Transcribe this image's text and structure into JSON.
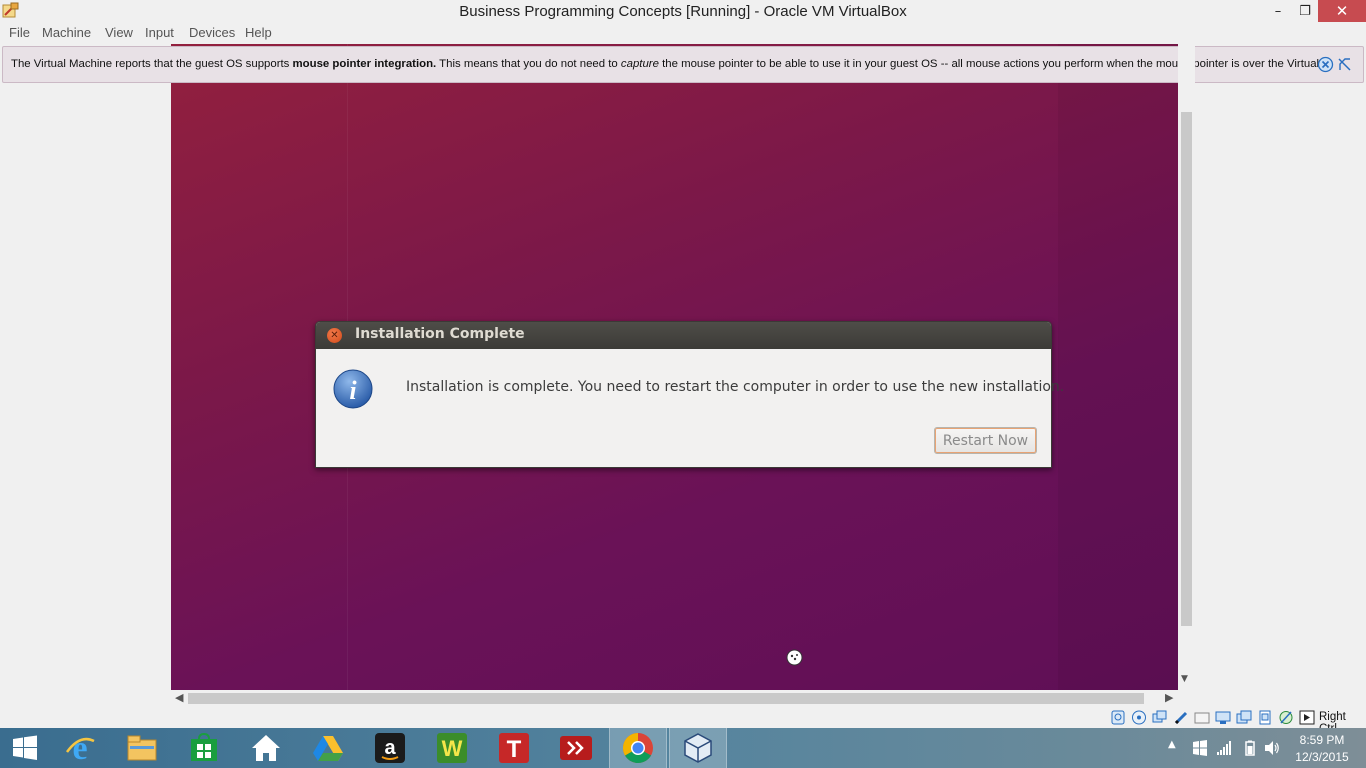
{
  "window": {
    "title": "Business Programming Concepts [Running] - Oracle VM VirtualBox",
    "minimize_glyph": "–",
    "restore_glyph": "❐",
    "close_glyph": "✕"
  },
  "menubar": {
    "items": [
      "File",
      "Machine",
      "View",
      "Input",
      "Devices",
      "Help"
    ]
  },
  "notification": {
    "text_before": "The Virtual Machine reports that the guest OS supports ",
    "bold": "mouse pointer integration.",
    "text_middle": " This means that you do not need to ",
    "italic": "capture",
    "text_after": " the mouse pointer to be able to use it in your guest OS -- all mouse actions you perform when the mouse pointer is over the Virtual"
  },
  "dialog": {
    "title": "Installation Complete",
    "message": "Installation is complete. You need to restart the computer in order to use the new installation.",
    "button": "Restart Now"
  },
  "statusbar": {
    "icons": [
      "hard-disk-icon",
      "optical-drive-icon",
      "audio-icon",
      "network-icon",
      "usb-icon",
      "shared-folders-icon",
      "display-icon",
      "video-capture-icon",
      "cpu-icon",
      "mouse-integration-icon",
      "keyboard-capture-icon"
    ],
    "host_key": "Right Ctrl"
  },
  "taskbar": {
    "apps": [
      "windows-start-icon",
      "internet-explorer-icon",
      "file-explorer-icon",
      "windows-store-icon",
      "home-icon",
      "google-drive-icon",
      "amazon-icon",
      "webucator-icon",
      "t-app-icon",
      "remote-app-icon",
      "chrome-icon",
      "virtualbox-icon"
    ],
    "clock": {
      "time": "8:59 PM",
      "date": "12/3/2015"
    }
  },
  "colors": {
    "ubuntu_purple": "#6a1257",
    "dialog_bg": "#f2f1f0",
    "close_red": "#c74b50"
  }
}
